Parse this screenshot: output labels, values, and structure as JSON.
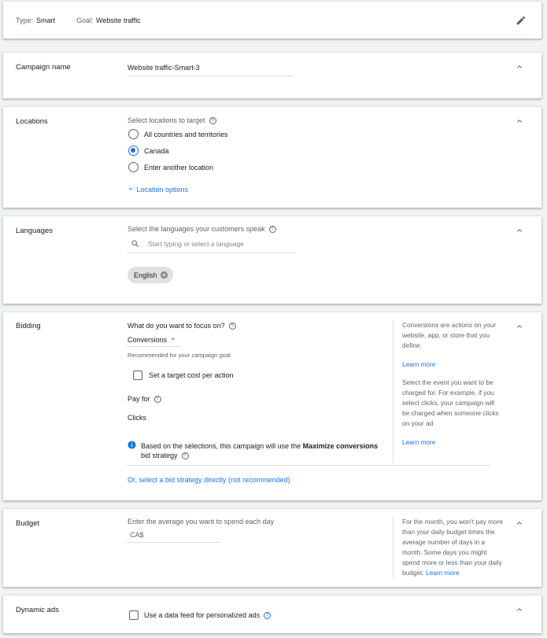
{
  "summary": {
    "type_label": "Type:",
    "type_value": "Smart",
    "goal_label": "Goal:",
    "goal_value": "Website traffic"
  },
  "campaign_name": {
    "title": "Campaign name",
    "value": "Website traffic-Smart-3"
  },
  "locations": {
    "title": "Locations",
    "prompt": "Select locations to target",
    "options": [
      "All countries and territories",
      "Canada",
      "Enter another location"
    ],
    "selected_index": 1,
    "location_options_link": "Location options"
  },
  "languages": {
    "title": "Languages",
    "prompt": "Select the languages your customers speak",
    "search_placeholder": "Start typing or select a language",
    "chip": "English"
  },
  "bidding": {
    "title": "Bidding",
    "focus_question": "What do you want to focus on?",
    "focus_value": "Conversions",
    "focus_hint": "Recommended for your campaign goal",
    "target_cpa_label": "Set a target cost per action",
    "pay_for_label": "Pay for",
    "pay_for_value": "Clicks",
    "info_prefix": "Based on the selections, this campaign will use the",
    "info_strategy": "Maximize conversions",
    "info_suffix": "bid strategy",
    "select_strategy_link": "Or, select a bid strategy directly (not recommended)",
    "side_1_lines": [
      "Conversions are actions on your",
      "website, app, or store that you",
      "define."
    ],
    "side_1_link": "Learn more",
    "side_2_lines": [
      "Select the event you want to be",
      "charged for. For example, if you",
      "select clicks, your campaign will",
      "be charged when someone clicks",
      "on your ad"
    ],
    "side_2_link": "Learn more"
  },
  "budget": {
    "title": "Budget",
    "prompt": "Enter the average you want to spend each day",
    "currency": "CA$",
    "side_lines": [
      "For the month, you won't pay more",
      "than your daily budget times the",
      "average number of days in a",
      "month. Some days you might",
      "spend more or less than your daily"
    ],
    "side_last": "budget.",
    "side_link": "Learn more"
  },
  "dynamic_ads": {
    "title": "Dynamic ads",
    "checkbox_label": "Use a data feed for personalized ads"
  },
  "colors": {
    "accent": "#1a73e8",
    "chip_bg": "#e0e0e0",
    "page_bg": "#f1f3f4"
  }
}
